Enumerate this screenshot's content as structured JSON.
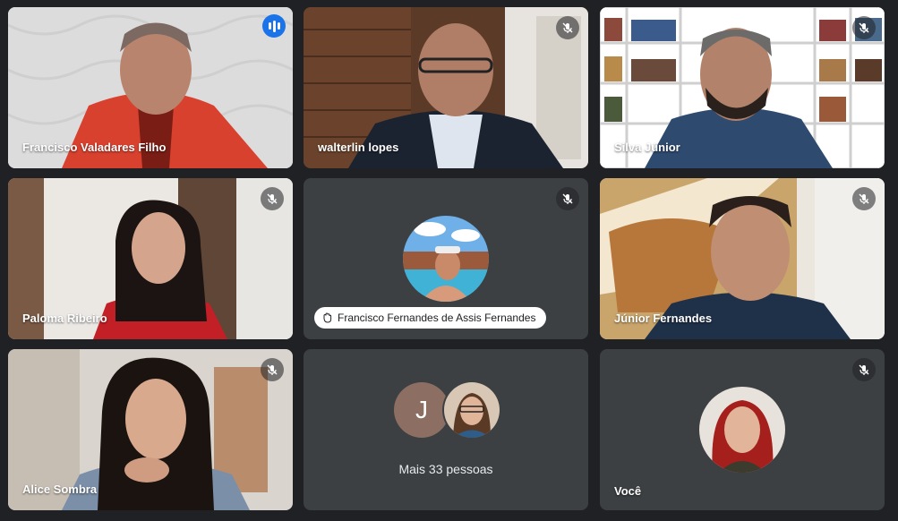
{
  "participants": [
    {
      "name": "Francisco Valadares Filho",
      "state": "speaking"
    },
    {
      "name": "walterlin lopes",
      "state": "muted"
    },
    {
      "name": "Silva Júnior",
      "state": "muted"
    },
    {
      "name": "Paloma Ribeiro",
      "state": "muted"
    },
    {
      "name": "Francisco Fernandes de Assis Fernandes",
      "state": "muted"
    },
    {
      "name": "Júnior Fernandes",
      "state": "muted"
    },
    {
      "name": "Alice Sombra",
      "state": "muted"
    },
    {
      "name": "Você",
      "state": "muted"
    }
  ],
  "others": {
    "initial": "J",
    "label": "Mais 33 pessoas"
  },
  "colors": {
    "accent": "#8ab4f8",
    "speaking_badge": "#1a73e8",
    "background": "#202124"
  }
}
